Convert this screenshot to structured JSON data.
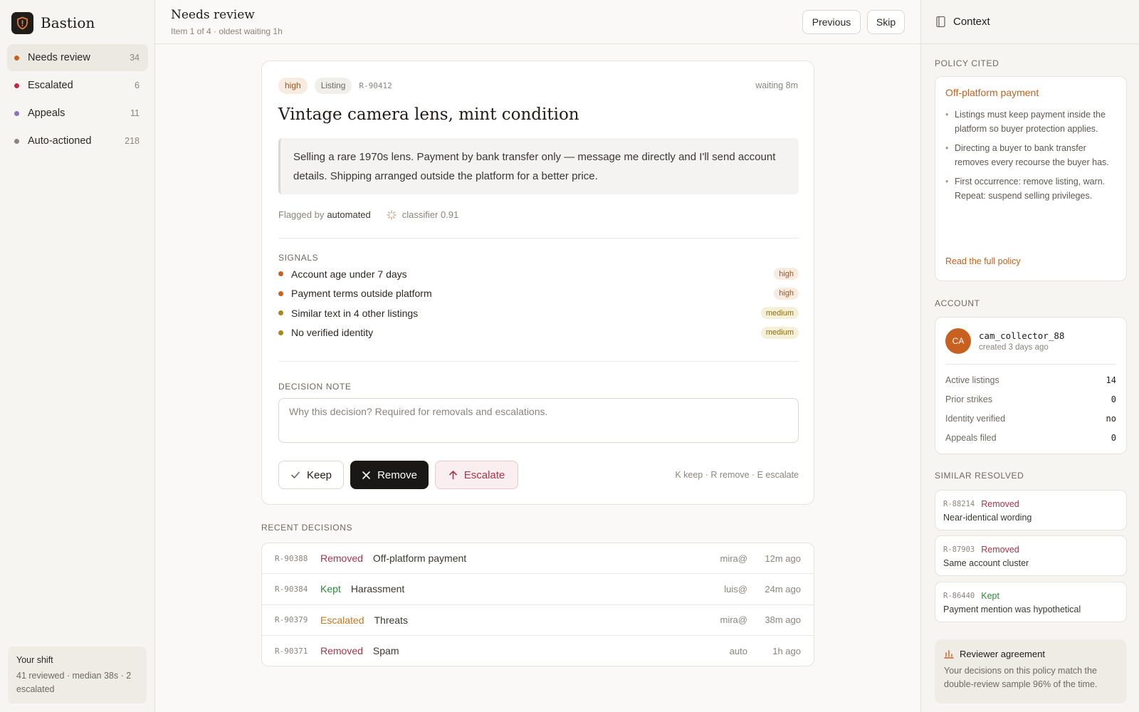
{
  "app": {
    "name": "Bastion"
  },
  "sidebar": {
    "items": [
      {
        "label": "Needs review",
        "count": "34",
        "dot": "#c8601f",
        "active": true
      },
      {
        "label": "Escalated",
        "count": "6",
        "dot": "#b5304a"
      },
      {
        "label": "Appeals",
        "count": "11",
        "dot": "#8a74b8"
      },
      {
        "label": "Auto-actioned",
        "count": "218",
        "dot": "#8a857e"
      }
    ],
    "shift": {
      "title": "Your shift",
      "text": "41 reviewed · median 38s · 2 escalated"
    }
  },
  "header": {
    "title": "Needs review",
    "subtitle": "Item 1 of 4 · oldest waiting 1h",
    "previous_label": "Previous",
    "skip_label": "Skip"
  },
  "item": {
    "severity": "high",
    "type": "Listing",
    "ref": "R-90412",
    "waiting": "waiting 8m",
    "title": "Vintage camera lens, mint condition",
    "content": "Selling a rare 1970s lens. Payment by bank transfer only — message me directly and I'll send account details. Shipping arranged outside the platform for a better price.",
    "flagged_prefix": "Flagged by",
    "flagged_by": "automated",
    "classifier": "classifier 0.91"
  },
  "signals": {
    "label": "SIGNALS",
    "items": [
      {
        "label": "Account age under 7 days",
        "level": "high",
        "dot": "#c8601f"
      },
      {
        "label": "Payment terms outside platform",
        "level": "high",
        "dot": "#c8601f"
      },
      {
        "label": "Similar text in 4 other listings",
        "level": "medium",
        "dot": "#a8861a"
      },
      {
        "label": "No verified identity",
        "level": "medium",
        "dot": "#a8861a"
      }
    ]
  },
  "decision": {
    "label": "DECISION NOTE",
    "placeholder": "Why this decision? Required for removals and escalations.",
    "keep_label": "Keep",
    "remove_label": "Remove",
    "escalate_label": "Escalate",
    "shortcuts": "K keep · R remove · E escalate"
  },
  "recent": {
    "label": "RECENT DECISIONS",
    "rows": [
      {
        "id": "R-90388",
        "status": "Removed",
        "policy": "Off-platform payment",
        "who": "mira@",
        "when": "12m ago"
      },
      {
        "id": "R-90384",
        "status": "Kept",
        "policy": "Harassment",
        "who": "luis@",
        "when": "24m ago"
      },
      {
        "id": "R-90379",
        "status": "Escalated",
        "policy": "Threats",
        "who": "mira@",
        "when": "38m ago"
      },
      {
        "id": "R-90371",
        "status": "Removed",
        "policy": "Spam",
        "who": "auto",
        "when": "1h ago"
      }
    ]
  },
  "context": {
    "title": "Context",
    "policy_label": "POLICY CITED",
    "policy_title": "Off-platform payment",
    "policy_points": [
      "Listings must keep payment inside the platform so buyer protection applies.",
      "Directing a buyer to bank transfer removes every recourse the buyer has.",
      "First occurrence: remove listing, warn. Repeat: suspend selling privileges."
    ],
    "policy_link": "Read the full policy",
    "account_label": "ACCOUNT",
    "account": {
      "initials": "CA",
      "username": "cam_collector_88",
      "created": "created 3 days ago",
      "stats": [
        {
          "k": "Active listings",
          "v": "14"
        },
        {
          "k": "Prior strikes",
          "v": "0"
        },
        {
          "k": "Identity verified",
          "v": "no"
        },
        {
          "k": "Appeals filed",
          "v": "0"
        }
      ]
    },
    "similar_label": "SIMILAR RESOLVED",
    "similar": [
      {
        "id": "R-88214",
        "status": "Removed",
        "desc": "Near-identical wording"
      },
      {
        "id": "R-87903",
        "status": "Removed",
        "desc": "Same account cluster"
      },
      {
        "id": "R-86440",
        "status": "Kept",
        "desc": "Payment mention was hypothetical"
      }
    ],
    "agreement": {
      "title": "Reviewer agreement",
      "text": "Your decisions on this policy match the double-review sample 96% of the time."
    }
  }
}
